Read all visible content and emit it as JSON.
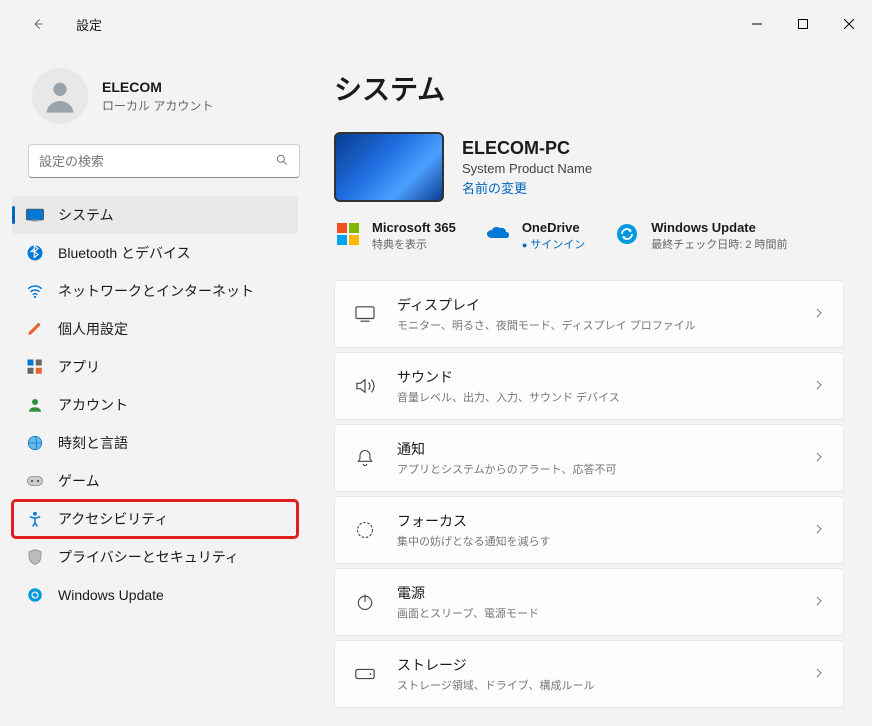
{
  "app_title": "設定",
  "user": {
    "name": "ELECOM",
    "sub": "ローカル アカウント"
  },
  "search": {
    "placeholder": "設定の検索"
  },
  "nav": {
    "items": [
      {
        "label": "システム"
      },
      {
        "label": "Bluetooth とデバイス"
      },
      {
        "label": "ネットワークとインターネット"
      },
      {
        "label": "個人用設定"
      },
      {
        "label": "アプリ"
      },
      {
        "label": "アカウント"
      },
      {
        "label": "時刻と言語"
      },
      {
        "label": "ゲーム"
      },
      {
        "label": "アクセシビリティ"
      },
      {
        "label": "プライバシーとセキュリティ"
      },
      {
        "label": "Windows Update"
      }
    ],
    "selected": "システム",
    "highlighted": "アクセシビリティ"
  },
  "page": {
    "title": "システム",
    "pc": {
      "name": "ELECOM-PC",
      "product": "System Product Name",
      "rename": "名前の変更"
    },
    "status": {
      "m365": {
        "title": "Microsoft 365",
        "sub": "特典を表示"
      },
      "onedrive": {
        "title": "OneDrive",
        "sub": "サインイン"
      },
      "update": {
        "title": "Windows Update",
        "sub": "最終チェック日時: 2 時間前"
      }
    },
    "cards": [
      {
        "title": "ディスプレイ",
        "sub": "モニター、明るさ、夜間モード、ディスプレイ プロファイル"
      },
      {
        "title": "サウンド",
        "sub": "音量レベル、出力、入力、サウンド デバイス"
      },
      {
        "title": "通知",
        "sub": "アプリとシステムからのアラート、応答不可"
      },
      {
        "title": "フォーカス",
        "sub": "集中の妨げとなる通知を減らす"
      },
      {
        "title": "電源",
        "sub": "画面とスリープ、電源モード"
      },
      {
        "title": "ストレージ",
        "sub": "ストレージ領域、ドライブ、構成ルール"
      }
    ]
  }
}
